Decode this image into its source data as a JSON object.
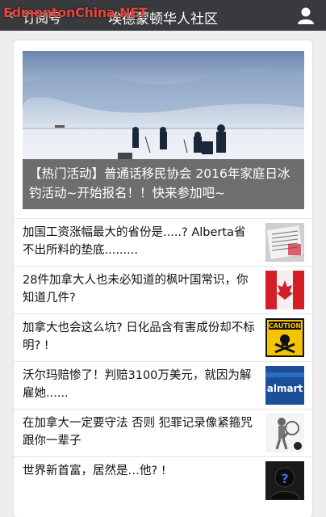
{
  "header": {
    "title": "埃德蒙顿华人社区",
    "back_label": "订阅号",
    "watermark": "EdmontonChina.NET"
  },
  "hero": {
    "caption": "【热门活动】普通话移民协会 2016年家庭日冰钓活动~开始报名！！快来参加吧~"
  },
  "articles": [
    {
      "title": "加国工资涨幅最大的省份是.....? Alberta省不出所料的垫底.........",
      "thumb_icon": "newspaper-thumbnail"
    },
    {
      "title": "28件加拿大人也未必知道的枫叶国常识，你知道几件?",
      "thumb_icon": "canada-flag-face-thumbnail"
    },
    {
      "title": "加拿大也会这么坑? 日化品含有害成份却不标明? !",
      "thumb_icon": "caution-poison-thumbnail",
      "caution_text": "CAUTION"
    },
    {
      "title": "沃尔玛赔惨了！判赔3100万美元，就因为解雇她......",
      "thumb_icon": "walmart-sign-thumbnail",
      "thumb_text": "almart"
    },
    {
      "title": "在加拿大一定要守法 否则 犯罪记录像紧箍咒跟你一辈子",
      "thumb_icon": "magnifier-figure-thumbnail"
    },
    {
      "title": "世界新首富，居然是…他? !",
      "thumb_icon": "mystery-person-thumbnail",
      "thumb_text": "?"
    }
  ],
  "colors": {
    "topbar": "#393a3e",
    "background": "#eeeeee",
    "watermark": "#e8443a"
  }
}
